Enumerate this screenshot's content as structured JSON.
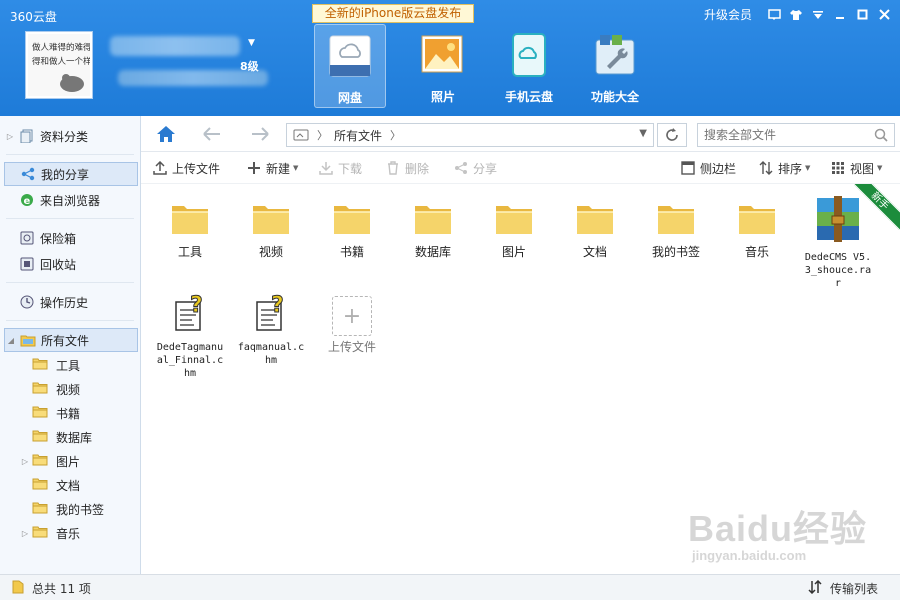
{
  "app": {
    "title": "360云盘",
    "banner": "全新的iPhone版云盘发布",
    "upgrade": "升级会员"
  },
  "user": {
    "level": "8级",
    "avatar_text": [
      "做人难得的难得",
      "得和做人一个样"
    ]
  },
  "nav": [
    {
      "label": "网盘",
      "icon": "cloud-drive-icon",
      "active": true
    },
    {
      "label": "照片",
      "icon": "photo-icon",
      "active": false
    },
    {
      "label": "手机云盘",
      "icon": "mobile-cloud-icon",
      "active": false
    },
    {
      "label": "功能大全",
      "icon": "toolbox-icon",
      "active": false
    }
  ],
  "sidebar": {
    "items": [
      {
        "label": "资料分类",
        "icon": "category-icon"
      },
      {
        "label": "我的分享",
        "icon": "share-icon",
        "selected": true
      },
      {
        "label": "来自浏览器",
        "icon": "browser-icon"
      },
      {
        "label": "保险箱",
        "icon": "safe-icon"
      },
      {
        "label": "回收站",
        "icon": "recycle-bin-icon"
      },
      {
        "label": "操作历史",
        "icon": "history-icon"
      },
      {
        "label": "所有文件",
        "icon": "all-files-icon",
        "selected": true
      }
    ],
    "folders": [
      "工具",
      "视频",
      "书籍",
      "数据库",
      "图片",
      "文档",
      "我的书签",
      "音乐"
    ]
  },
  "address": {
    "path": "所有文件",
    "search_placeholder": "搜索全部文件"
  },
  "toolbar": {
    "upload": "上传文件",
    "new": "新建",
    "download": "下载",
    "delete": "删除",
    "share": "分享",
    "sidebar": "侧边栏",
    "sort": "排序",
    "view": "视图"
  },
  "files": [
    {
      "name": "工具",
      "type": "folder"
    },
    {
      "name": "视频",
      "type": "folder"
    },
    {
      "name": "书籍",
      "type": "folder"
    },
    {
      "name": "数据库",
      "type": "folder"
    },
    {
      "name": "图片",
      "type": "folder"
    },
    {
      "name": "文档",
      "type": "folder"
    },
    {
      "name": "我的书签",
      "type": "folder"
    },
    {
      "name": "音乐",
      "type": "folder"
    },
    {
      "name": "DedeCMS V5.3_shouce.rar",
      "type": "rar",
      "badge": "新手"
    },
    {
      "name": "DedeTagmanual_Finnal.chm",
      "type": "chm"
    },
    {
      "name": "faqmanual.chm",
      "type": "chm"
    },
    {
      "name": "上传文件",
      "type": "upload"
    }
  ],
  "status": {
    "total": "总共 11 项",
    "transfer": "传输列表"
  },
  "watermark": {
    "brand": "Baidu经验",
    "url": "jingyan.baidu.com"
  },
  "colors": {
    "header": "#2f8ce6",
    "folder": "#f5d46a",
    "selected": "#dde9f8"
  }
}
